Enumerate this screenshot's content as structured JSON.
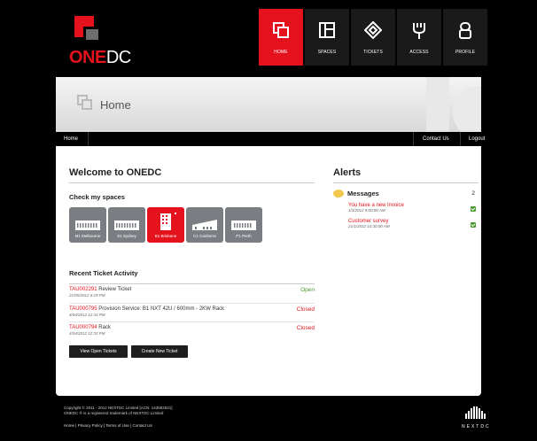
{
  "brand": {
    "one": "ONE",
    "dc": "DC"
  },
  "nav": [
    {
      "label": "HOME",
      "icon": "home-icon",
      "active": true
    },
    {
      "label": "SPACES",
      "icon": "spaces-icon",
      "active": false
    },
    {
      "label": "TICKETS",
      "icon": "tickets-icon",
      "active": false
    },
    {
      "label": "ACCESS",
      "icon": "access-icon",
      "active": false
    },
    {
      "label": "PROFILE",
      "icon": "profile-icon",
      "active": false
    }
  ],
  "banner": {
    "title": "Home"
  },
  "subbar": {
    "home": "Home",
    "contact": "Contact Us",
    "logout": "Logout"
  },
  "welcome": "Welcome to ONEDC",
  "check_spaces": "Check my spaces",
  "spaces": [
    {
      "label": "M1 Melbourne",
      "active": false
    },
    {
      "label": "S1 Sydney",
      "active": false
    },
    {
      "label": "B1 Brisbane",
      "active": true
    },
    {
      "label": "C1 Canberra",
      "active": false
    },
    {
      "label": "P1 Perth",
      "active": false
    }
  ],
  "recent_title": "Recent Ticket Activity",
  "tickets": [
    {
      "id": "TAU002291",
      "desc": "Review Ticket",
      "date": "21/05/2012 6:19 PM",
      "status": "Open"
    },
    {
      "id": "TAU000795",
      "desc": "Provision Service: B1 NXT 42U / 600mm - 2KW Rack",
      "date": "4/04/2012 12:33 PM",
      "status": "Closed"
    },
    {
      "id": "TAU000794",
      "desc": "Rack",
      "date": "4/04/2012 12:33 PM",
      "status": "Closed"
    }
  ],
  "buttons": {
    "view_open": "View Open Tickets",
    "create_new": "Create New Ticket"
  },
  "alerts": {
    "title": "Alerts",
    "messages_label": "Messages",
    "messages_count": "2",
    "items": [
      {
        "title": "You have a new invoice",
        "date": "1/3/2012 9:00:00 AM"
      },
      {
        "title": "Customer survey",
        "date": "21/1/2012 10:30:00 AM"
      }
    ]
  },
  "footer": {
    "copyright": "Copyright © 2011 - 2012 NEXTDC Limited [ACN: 143582521]",
    "trademark": "ONEDC ® is a registered trademark of NEXTDC Limited",
    "links": [
      "Home",
      "Privacy Policy",
      "Terms of Use",
      "Contact Us"
    ],
    "link_sep": " | ",
    "brand": "NEXTDC"
  },
  "colors": {
    "accent": "#e3121c",
    "open": "#4a9a2f",
    "tile": "#7a7d82"
  }
}
